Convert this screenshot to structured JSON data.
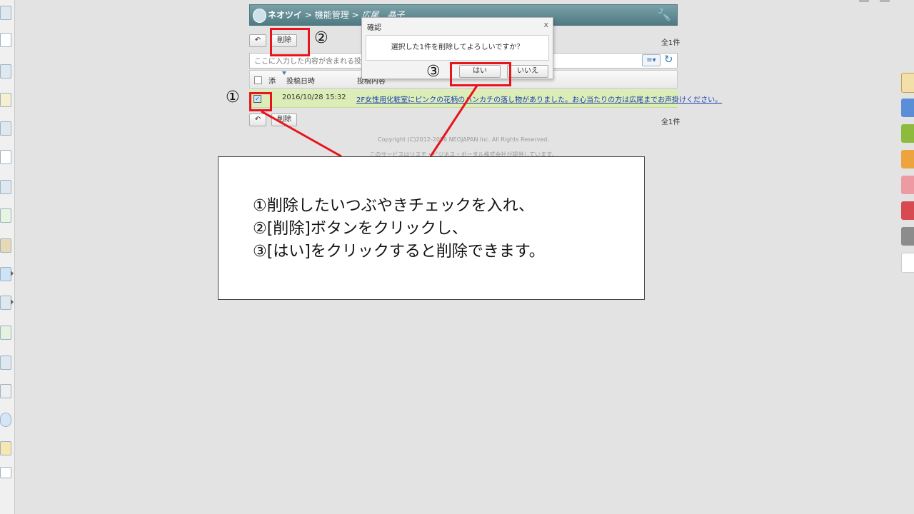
{
  "header": {
    "app_name": "ネオツイ",
    "sep1": " > ",
    "section": "機能管理",
    "sep2": " > ",
    "user": "広尾　晶子"
  },
  "toolbar": {
    "back_label": "",
    "delete_label": "削除",
    "count": "全1件"
  },
  "search": {
    "placeholder": "ここに入力した内容が含まれる投稿を"
  },
  "table": {
    "col_attach": "添",
    "col_date": "投稿日時",
    "col_content": "投稿内容",
    "rows": [
      {
        "date": "2016/10/28 15:32",
        "content": "2F女性用化粧室にピンクの花柄のハンカチの落し物がありました。お心当たりの方は広尾までお声掛けください。"
      }
    ]
  },
  "footer": {
    "delete_label": "削除",
    "count": "全1件",
    "copyright": "Copyright (C)2012-2016 NEOJAPAN Inc. All Rights Reserved.",
    "service": "このサービスはリスモ・ビジネス・ポータル株式会社が提供しています。"
  },
  "dialog": {
    "title": "確認",
    "close": "x",
    "message": "選択した1件を削除してよろしいですか？",
    "yes_label": "はい",
    "no_label": "いいえ"
  },
  "annotations": {
    "num1": "①",
    "num2": "②",
    "num3": "③",
    "line1": "①削除したいつぶやきチェックを入れ、",
    "line2": "②[削除]ボタンをクリックし、",
    "line3": "③[はい]をクリックすると削除できます。"
  },
  "colors": {
    "header_bg": "#5f8a92",
    "highlight_row": "#ddedb8",
    "annotation_red": "#e8141b"
  }
}
